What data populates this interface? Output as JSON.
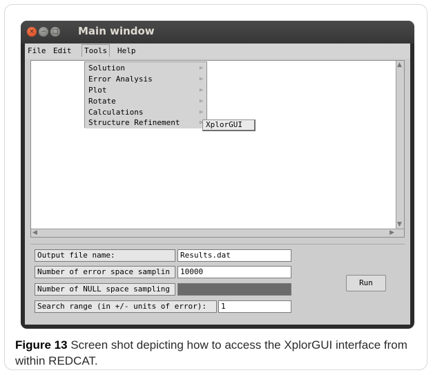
{
  "window": {
    "title": "Main window",
    "controls": {
      "close_glyph": "×",
      "min_glyph": "−",
      "max_glyph": "□"
    }
  },
  "menubar": {
    "items": [
      "File",
      "Edit",
      "Tools",
      "Help"
    ],
    "open_menu": "Tools"
  },
  "tools_menu": {
    "items": [
      {
        "label": "Solution",
        "has_submenu": true
      },
      {
        "label": "Error Analysis",
        "has_submenu": true
      },
      {
        "label": "Plot",
        "has_submenu": true
      },
      {
        "label": "Rotate",
        "has_submenu": true
      },
      {
        "label": "Calculations",
        "has_submenu": true
      },
      {
        "label": "Structure Refinement",
        "has_submenu": true
      }
    ],
    "submenu_arrow": "⊳"
  },
  "submenu": {
    "items": [
      "XplorGUI"
    ]
  },
  "form": {
    "output_file": {
      "label": "Output file name:",
      "value": "Results.dat"
    },
    "error_sampling": {
      "label": "Number of error space samplin",
      "value": "10000"
    },
    "null_sampling": {
      "label": "Number of NULL space sampling",
      "value": ""
    },
    "search_range": {
      "label": "Search range (in +/- units of error):",
      "value": "1"
    },
    "run_label": "Run"
  },
  "caption": {
    "figure_label": "Figure 13",
    "text": "Screen shot depicting how to access the XplorGUI interface from within REDCAT."
  },
  "colors": {
    "titlebar": "#3c3b37",
    "close": "#df4a16",
    "client": "#cdcdcd",
    "disabled_field": "#6b6b6b"
  }
}
